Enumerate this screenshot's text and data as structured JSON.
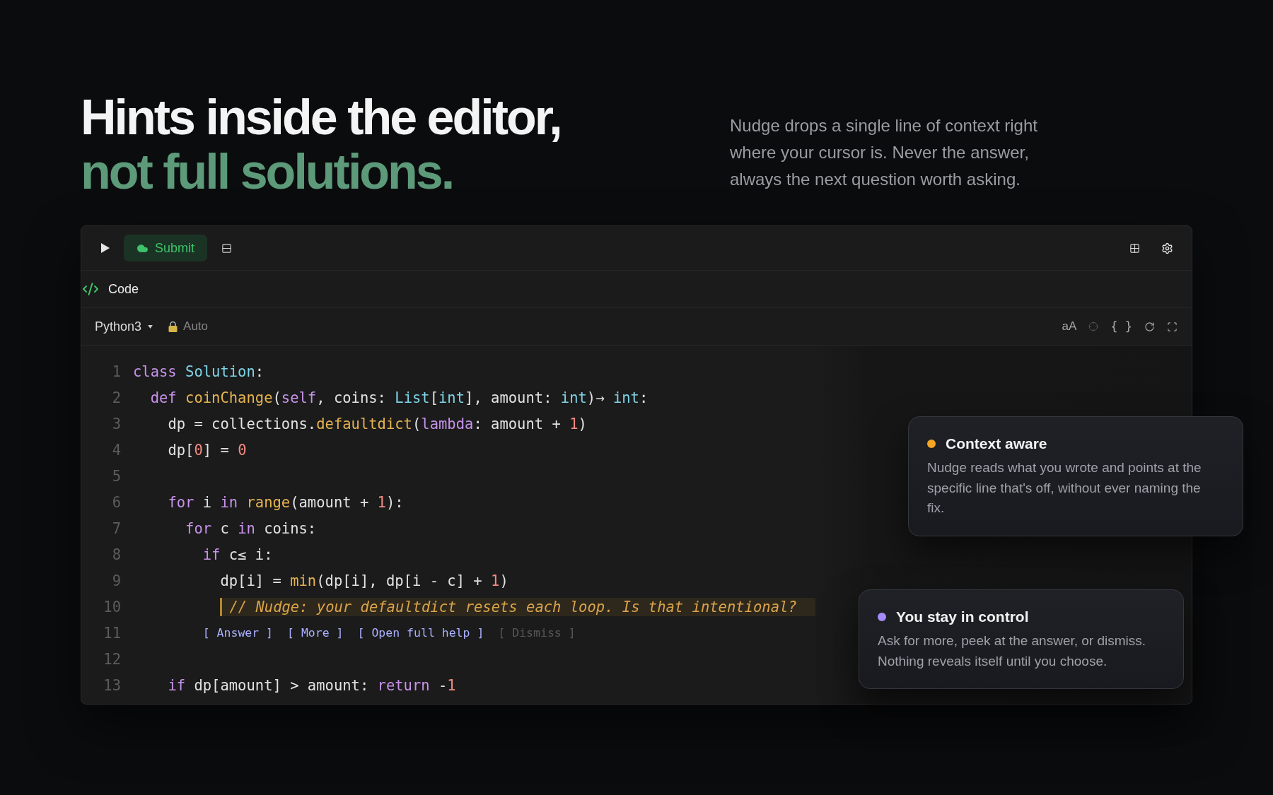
{
  "headline": {
    "line_1": "Hints inside the editor,",
    "line_2": "not full solutions."
  },
  "intro": "Nudge drops a single line of context right where your cursor is. Never the answer, always the next question worth asking.",
  "editor": {
    "submit_button": "Submit",
    "panel_title": "Code",
    "language": "Python3",
    "mode": "Auto",
    "font_size_button": "aA",
    "format_button": "{ }",
    "lines": [
      {
        "number": "1",
        "kind": "code",
        "tokens": [
          {
            "text": "class ",
            "kind": "keyword"
          },
          {
            "text": "Solution",
            "kind": "type"
          },
          {
            "text": ":",
            "kind": "plain"
          }
        ]
      },
      {
        "number": "2",
        "kind": "code",
        "tokens": [
          {
            "text": "  def ",
            "kind": "keyword"
          },
          {
            "text": "coinChange",
            "kind": "function"
          },
          {
            "text": "(",
            "kind": "plain"
          },
          {
            "text": "self",
            "kind": "keyword"
          },
          {
            "text": ", coins: ",
            "kind": "plain"
          },
          {
            "text": "List",
            "kind": "type"
          },
          {
            "text": "[",
            "kind": "plain"
          },
          {
            "text": "int",
            "kind": "type"
          },
          {
            "text": "], amount: ",
            "kind": "plain"
          },
          {
            "text": "int",
            "kind": "type"
          },
          {
            "text": ")→ ",
            "kind": "plain"
          },
          {
            "text": "int",
            "kind": "type"
          },
          {
            "text": ":",
            "kind": "plain"
          }
        ]
      },
      {
        "number": "3",
        "kind": "code",
        "tokens": [
          {
            "text": "    dp = collections.",
            "kind": "plain"
          },
          {
            "text": "defaultdict",
            "kind": "function"
          },
          {
            "text": "(",
            "kind": "plain"
          },
          {
            "text": "lambda",
            "kind": "keyword"
          },
          {
            "text": ": amount + ",
            "kind": "plain"
          },
          {
            "text": "1",
            "kind": "number"
          },
          {
            "text": ")",
            "kind": "plain"
          }
        ]
      },
      {
        "number": "4",
        "kind": "code",
        "tokens": [
          {
            "text": "    dp[",
            "kind": "plain"
          },
          {
            "text": "0",
            "kind": "number"
          },
          {
            "text": "] = ",
            "kind": "plain"
          },
          {
            "text": "0",
            "kind": "number"
          }
        ]
      },
      {
        "number": "5",
        "kind": "code"
      },
      {
        "number": "6",
        "kind": "code",
        "tokens": [
          {
            "text": "    for ",
            "kind": "keyword"
          },
          {
            "text": "i ",
            "kind": "plain"
          },
          {
            "text": "in ",
            "kind": "keyword"
          },
          {
            "text": "range",
            "kind": "function"
          },
          {
            "text": "(amount + ",
            "kind": "plain"
          },
          {
            "text": "1",
            "kind": "number"
          },
          {
            "text": "):",
            "kind": "plain"
          }
        ]
      },
      {
        "number": "7",
        "kind": "code",
        "tokens": [
          {
            "text": "      for ",
            "kind": "keyword"
          },
          {
            "text": "c ",
            "kind": "plain"
          },
          {
            "text": "in ",
            "kind": "keyword"
          },
          {
            "text": "coins:",
            "kind": "plain"
          }
        ]
      },
      {
        "number": "8",
        "kind": "code",
        "tokens": [
          {
            "text": "        if ",
            "kind": "keyword"
          },
          {
            "text": "c≤ i:",
            "kind": "plain"
          }
        ]
      },
      {
        "number": "9",
        "kind": "code",
        "tokens": [
          {
            "text": "          dp[i] = ",
            "kind": "plain"
          },
          {
            "text": "min",
            "kind": "function"
          },
          {
            "text": "(dp[i], dp[i - c] + ",
            "kind": "plain"
          },
          {
            "text": "1",
            "kind": "number"
          },
          {
            "text": ")",
            "kind": "plain"
          }
        ]
      },
      {
        "number": "10",
        "kind": "hint",
        "text": "          // Nudge: your defaultdict resets each loop. Is that intentional?"
      },
      {
        "number": "11",
        "kind": "actions",
        "actions": [
          {
            "label": "[ Answer ]",
            "dimmed": false
          },
          {
            "label": "[ More ]",
            "dimmed": false
          },
          {
            "label": "[ Open full help ]",
            "dimmed": false
          },
          {
            "label": "[ Dismiss ]",
            "dimmed": true
          }
        ]
      },
      {
        "number": "12",
        "kind": "code"
      },
      {
        "number": "13",
        "kind": "code",
        "tokens": [
          {
            "text": "    if ",
            "kind": "keyword"
          },
          {
            "text": "dp[amount] > amount: ",
            "kind": "plain"
          },
          {
            "text": "return ",
            "kind": "keyword"
          },
          {
            "text": "-",
            "kind": "plain"
          },
          {
            "text": "1",
            "kind": "number"
          }
        ]
      }
    ]
  },
  "callouts": [
    {
      "title": "Context aware",
      "text": "Nudge reads what you wrote and points at the specific line that's off, without ever naming the fix.",
      "color": "#f5a524"
    },
    {
      "title": "You stay in control",
      "text": "Ask for more, peek at the answer, or dismiss. Nothing reveals itself until you choose.",
      "color": "#a78bfa"
    }
  ]
}
